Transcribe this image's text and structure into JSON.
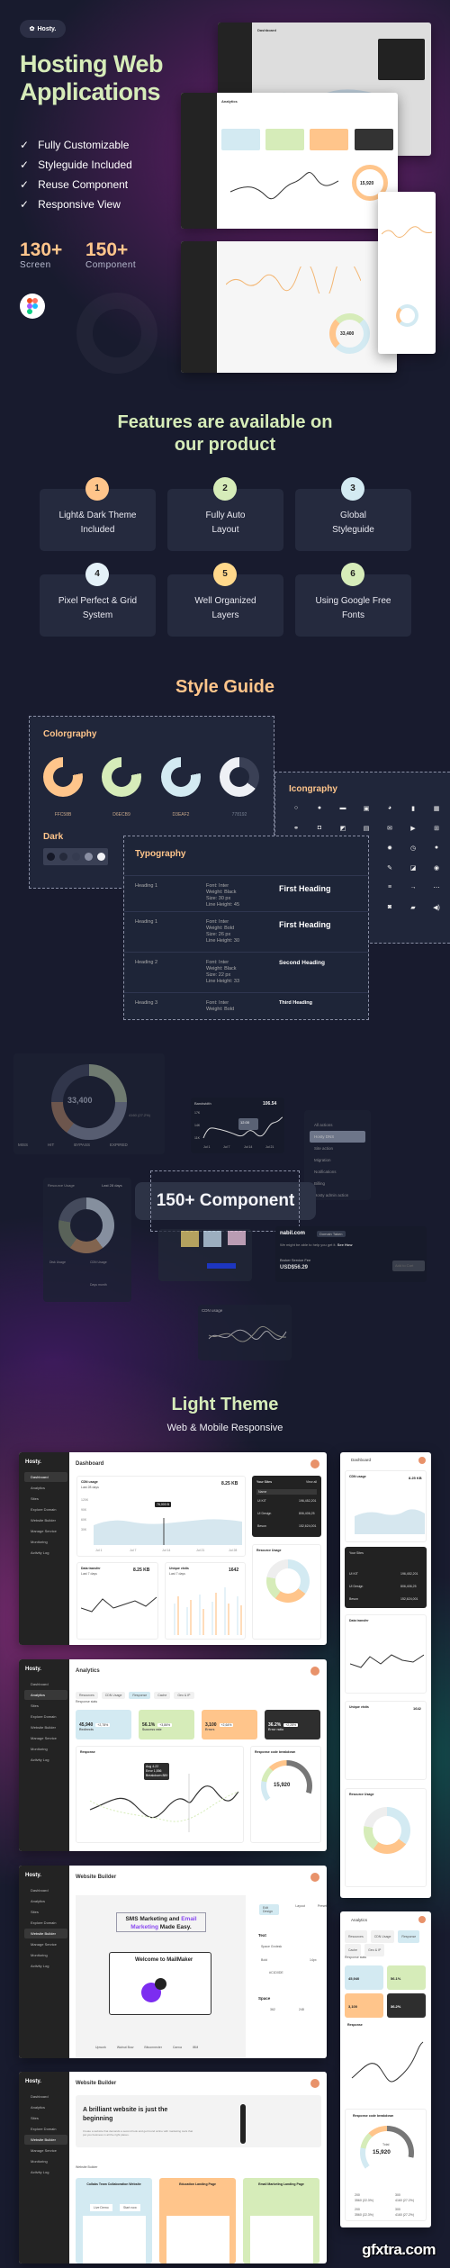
{
  "brand": "Hosty.",
  "hero": {
    "title_line1": "Hosting Web",
    "title_line2": "Applications",
    "features": [
      "Fully Customizable",
      "Styleguide Included",
      "Reuse Component",
      "Responsive View"
    ],
    "stats": [
      {
        "value": "130+",
        "label": "Screen"
      },
      {
        "value": "150+",
        "label": "Component"
      }
    ]
  },
  "features_section": {
    "title_line1": "Features are available on",
    "title_line2": "our product",
    "items": [
      {
        "num": "1",
        "label": "Light& Dark Theme Included",
        "color": "#ffc58b"
      },
      {
        "num": "2",
        "label": "Fully Auto Layout",
        "color": "#d6ecb9"
      },
      {
        "num": "3",
        "label": "Global Styleguide",
        "color": "#d3eaf2"
      },
      {
        "num": "4",
        "label": "Pixel Perfect & Grid System",
        "color": "#e4f1f8"
      },
      {
        "num": "5",
        "label": "Well Organized Layers",
        "color": "#ffd88b"
      },
      {
        "num": "6",
        "label": "Using Google Free Fonts",
        "color": "#d6ecb9"
      }
    ]
  },
  "style_guide": {
    "title": "Style Guide",
    "colorgraphy": {
      "title": "Colorgraphy",
      "colors": [
        {
          "hex": "FFC58B",
          "color": "#ffc58b"
        },
        {
          "hex": "D6ECB9",
          "color": "#d6ecb9"
        },
        {
          "hex": "D3EAF2",
          "color": "#d3eaf2"
        },
        {
          "hex": "778192",
          "color": "#778192"
        }
      ],
      "dark_label": "Dark",
      "dark_swatches": [
        "#151827",
        "#252a3b",
        "#3a4055",
        "#8a8fa3",
        "#f1f2f6"
      ]
    },
    "iconography": {
      "title": "Icongraphy",
      "icons": [
        "search",
        "search-filled",
        "folder",
        "image",
        "pie-chart",
        "bookmark",
        "grid",
        "link",
        "scan",
        "edit-image",
        "calendar",
        "mail",
        "video",
        "plus-square",
        "settings",
        "clock",
        "info",
        "pen",
        "edit",
        "target",
        "menu",
        "arrow-right",
        "more",
        "camera",
        "bag",
        "volume"
      ]
    },
    "typography": {
      "title": "Typography",
      "rows": [
        {
          "name": "Heading 1",
          "spec": [
            "Font: Inter",
            "Weight: Black",
            "Size: 30 px",
            "Line Height: 45"
          ],
          "sample": "First Heading"
        },
        {
          "name": "Heading 1",
          "spec": [
            "Font: Inter",
            "Weight: Bold",
            "Size: 26 px",
            "Line Height: 30"
          ],
          "sample": "First Heading"
        },
        {
          "name": "Heading 2",
          "spec": [
            "Font: Inter",
            "Weight: Black",
            "Size: 22 px",
            "Line Height: 33"
          ],
          "sample": "Second Heading"
        },
        {
          "name": "Heading 3",
          "spec": [
            "Font: Inter",
            "Weight: Bold"
          ],
          "sample": "Third Heading"
        }
      ]
    }
  },
  "components": {
    "title": "150+ Component",
    "donut": {
      "total_label": "Total",
      "total": "33,400",
      "callout": "4160 (27.2%)",
      "legend": [
        "MISS",
        "HIT",
        "BYPASS",
        "EXPIRED"
      ]
    },
    "bandwidth": {
      "title": "Bandwidth",
      "value": "106.54",
      "tooltip": "12.00",
      "ticks": [
        "Jul 1",
        "Jul 7",
        "Jul 14",
        "Jul 21"
      ],
      "y": [
        "17K",
        "14K",
        "11K"
      ]
    },
    "actions": [
      "All actions",
      "Hosty DNS",
      "Site action",
      "Migration",
      "Notifications",
      "Billing",
      "Hosty admin action"
    ],
    "resource": {
      "title": "Resource Usage",
      "period": "Last 28 days",
      "items": [
        "Disk Usage",
        "CDN Usage",
        "Visits",
        "Days month"
      ]
    },
    "domain": {
      "name": "nabil.com",
      "badge": "Domain Taken",
      "text": "We might be able to help you get it.",
      "link": "See How",
      "fee_label": "Broker Service Fee",
      "fee": "USD$56.29",
      "button": "Add to Cart"
    },
    "cdn": {
      "title": "CDN usage"
    },
    "legend2": [
      "Error",
      "Breakdown"
    ]
  },
  "light": {
    "title": "Light Theme",
    "subtitle": "Web & Mobile Responsive"
  },
  "nav": [
    "Dashboard",
    "Analytics",
    "Sites",
    "Explore Domain",
    "Website Builder",
    "Manage Service",
    "Monitoring",
    "Activity Log"
  ],
  "dashboard": {
    "title": "Dashboard",
    "cdn_title": "CDN usage",
    "cdn_period": "Last 28 days",
    "cdn_value": "8.25 KB",
    "tooltip": "76,000 B",
    "x_ticks": [
      "Jul 1",
      "Jul 7",
      "Jul 14",
      "Jul 21",
      "Jul 28"
    ],
    "y_ticks": [
      "120K",
      "90K",
      "60K",
      "30K",
      "0K"
    ],
    "sites_title": "Your Sites",
    "view_all": "View all",
    "sites_cols": [
      "Name",
      "Visit"
    ],
    "sites": [
      {
        "name": "UI KIT",
        "url": "www.uikit.io",
        "visit": "196,452,201"
      },
      {
        "name": "UI Design",
        "url": "www.uidesign.io",
        "visit": "806,406,25"
      },
      {
        "name": "Beson",
        "url": "www.beson.agency",
        "visit": "152,624,001"
      }
    ],
    "resource_title": "Resource Usage",
    "resource_period": "Last 28 days",
    "transfer_title": "Data transfer",
    "transfer_period": "Last 7 days",
    "transfer_value": "8.25 KB",
    "visits_title": "Unique visits",
    "visits_period": "Last 7 days",
    "visits_value": "1642"
  },
  "analytics": {
    "title": "Analytics",
    "tabs": [
      "Resources",
      "CDN Usage",
      "Response",
      "Cache",
      "Geo & IP"
    ],
    "section": "Response stats",
    "tiles": [
      {
        "value": "45,940",
        "label": "Redirects",
        "delta": "+2,78%",
        "bg": "#d3eaf2"
      },
      {
        "value": "56.1%",
        "label": "Success rate",
        "delta": "+3,86%",
        "bg": "#d6ecb9"
      },
      {
        "value": "3,100",
        "label": "Errors",
        "delta": "+2,64%",
        "bg": "#ffc58b"
      },
      {
        "value": "36.2%",
        "label": "Error ratio",
        "delta": "+2,28%",
        "bg": "#2e2e2e"
      }
    ],
    "chart_title": "Response",
    "legend": [
      "Error",
      "Breakdown"
    ],
    "tooltip": [
      "Aug 4-22",
      "Error 1,556",
      "Breakdown 889"
    ],
    "breakdown_title": "Response code breakdown",
    "total_label": "Total",
    "total": "15,920",
    "codes": [
      {
        "code": "200",
        "detail": "3560 (22.3%)"
      },
      {
        "code": "300",
        "detail": "4160 (27.2%)"
      },
      {
        "code": "200",
        "detail": "3560 (22.3%)"
      },
      {
        "code": "300",
        "detail": "4160 (27.2%)"
      }
    ]
  },
  "builder": {
    "title": "Website Builder",
    "headline_a": "SMS Marketing and ",
    "headline_b": "Email Marketing",
    "headline_c": " Made Easy.",
    "welcome": "Welcome to MailMaker",
    "panel_tabs": [
      "Edit Design",
      "Layout",
      "Preset"
    ],
    "text_label": "Text",
    "font": "Space Grotesk",
    "weight": "Bold",
    "size": "14px",
    "color": "#C1D0DE",
    "space_label": "Space",
    "w": "362",
    "h": "248",
    "brands": [
      "Upwork",
      "Walnut Bow",
      "Bitconnecter",
      "Canva",
      "IBM"
    ]
  },
  "builder2": {
    "title": "Website Builder",
    "hero": "A brilliant website is just the beginning",
    "hero_text": "Create a website that demands a second look and get found online with marketing tools that put you business in all the right places.",
    "section": "Website Builder",
    "templates": [
      {
        "title": "Collabs Team Collaboration Website",
        "bg": "#d3eaf2"
      },
      {
        "title": "Education Landing Page",
        "bg": "#ffc58b"
      },
      {
        "title": "Email Marketing Landing Page",
        "bg": "#d6ecb9"
      }
    ],
    "btn_demo": "Live Demo",
    "btn_start": "Start now"
  },
  "watermark": "gfxtra.com"
}
